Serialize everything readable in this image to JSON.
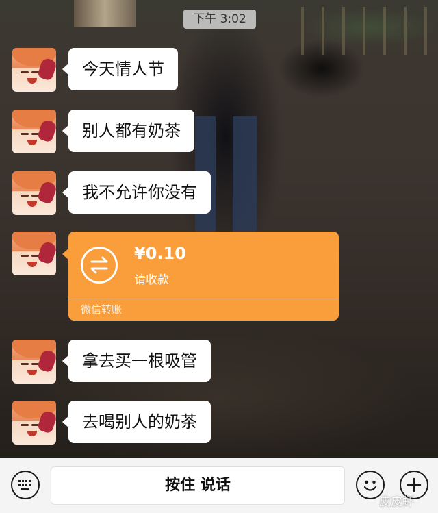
{
  "status": {
    "time": "下午 3:02"
  },
  "messages": [
    {
      "text": "今天情人节"
    },
    {
      "text": "别人都有奶茶"
    },
    {
      "text": "我不允许你没有"
    },
    {
      "transfer": {
        "amount": "¥0.10",
        "status": "请收款",
        "label": "微信转账"
      }
    },
    {
      "text": "拿去买一根吸管"
    },
    {
      "text": "去喝别人的奶茶"
    }
  ],
  "input_bar": {
    "hold_to_talk": "按住 说话",
    "left_icon": "keyboard-icon",
    "emoji_icon": "emoji-icon",
    "plus_icon": "plus-icon"
  },
  "watermark": "皮皮虾",
  "colors": {
    "transfer_bg": "#fa9d3b",
    "bubble_bg": "#ffffff",
    "input_bar_bg": "#f4f4f4"
  }
}
